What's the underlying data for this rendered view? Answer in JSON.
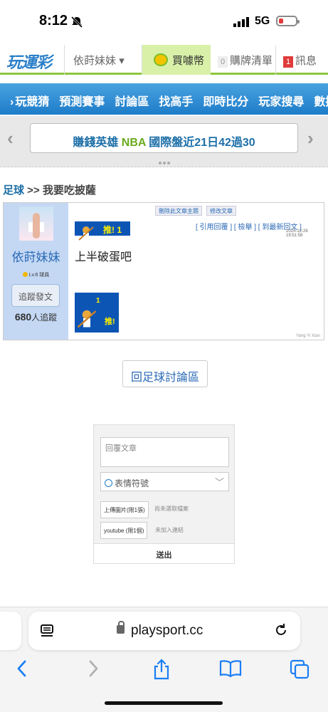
{
  "status_bar": {
    "time": "8:12",
    "network": "5G"
  },
  "top_nav": {
    "logo": "玩運彩",
    "user": "依莳妹妹",
    "buy_coin": "買噱幣",
    "cart_count": "0",
    "cart_label": "購牌清單",
    "msg_count": "1",
    "msg_label": "訊息"
  },
  "main_nav": {
    "items": [
      "玩競猜",
      "預測賽事",
      "討論區",
      "找高手",
      "即時比分",
      "玩家搜尋",
      "數據"
    ]
  },
  "ticker": {
    "text_a": "賺錢英雄 ",
    "text_b": "NBA",
    "text_c": " 國際盤近21日42過30"
  },
  "breadcrumb": {
    "section": "足球",
    "sep": " >> ",
    "title": "我要吃披薩"
  },
  "post": {
    "author": "依莳妹妹",
    "level": "Lv.6 球員",
    "follow_btn": "追蹤發文",
    "followers_count": "680",
    "followers_label": "人追蹤",
    "admin_delete": "刪除此文章主題",
    "admin_edit": "修改文章",
    "push_top": "推! 1",
    "actions": "[ 引用回覆 ]  [ 檢舉 ]  [ 到最新回文 ]",
    "timestamp": "2024-12-26 19:51:58",
    "content": "上半破蛋吧",
    "push_count": "1",
    "push_label": "推!",
    "signature": "Yang Yi Xian"
  },
  "back_link": "回足球討論區",
  "reply_form": {
    "placeholder": "回覆文章",
    "emoji_label": "表情符號",
    "upload_btn": "上傳圖片(限1張)",
    "upload_note": "尚未選取檔案",
    "youtube_btn": "youtube (限1個)",
    "youtube_note": "未加入連結",
    "submit": "送出"
  },
  "safari": {
    "url": "playsport.cc"
  }
}
